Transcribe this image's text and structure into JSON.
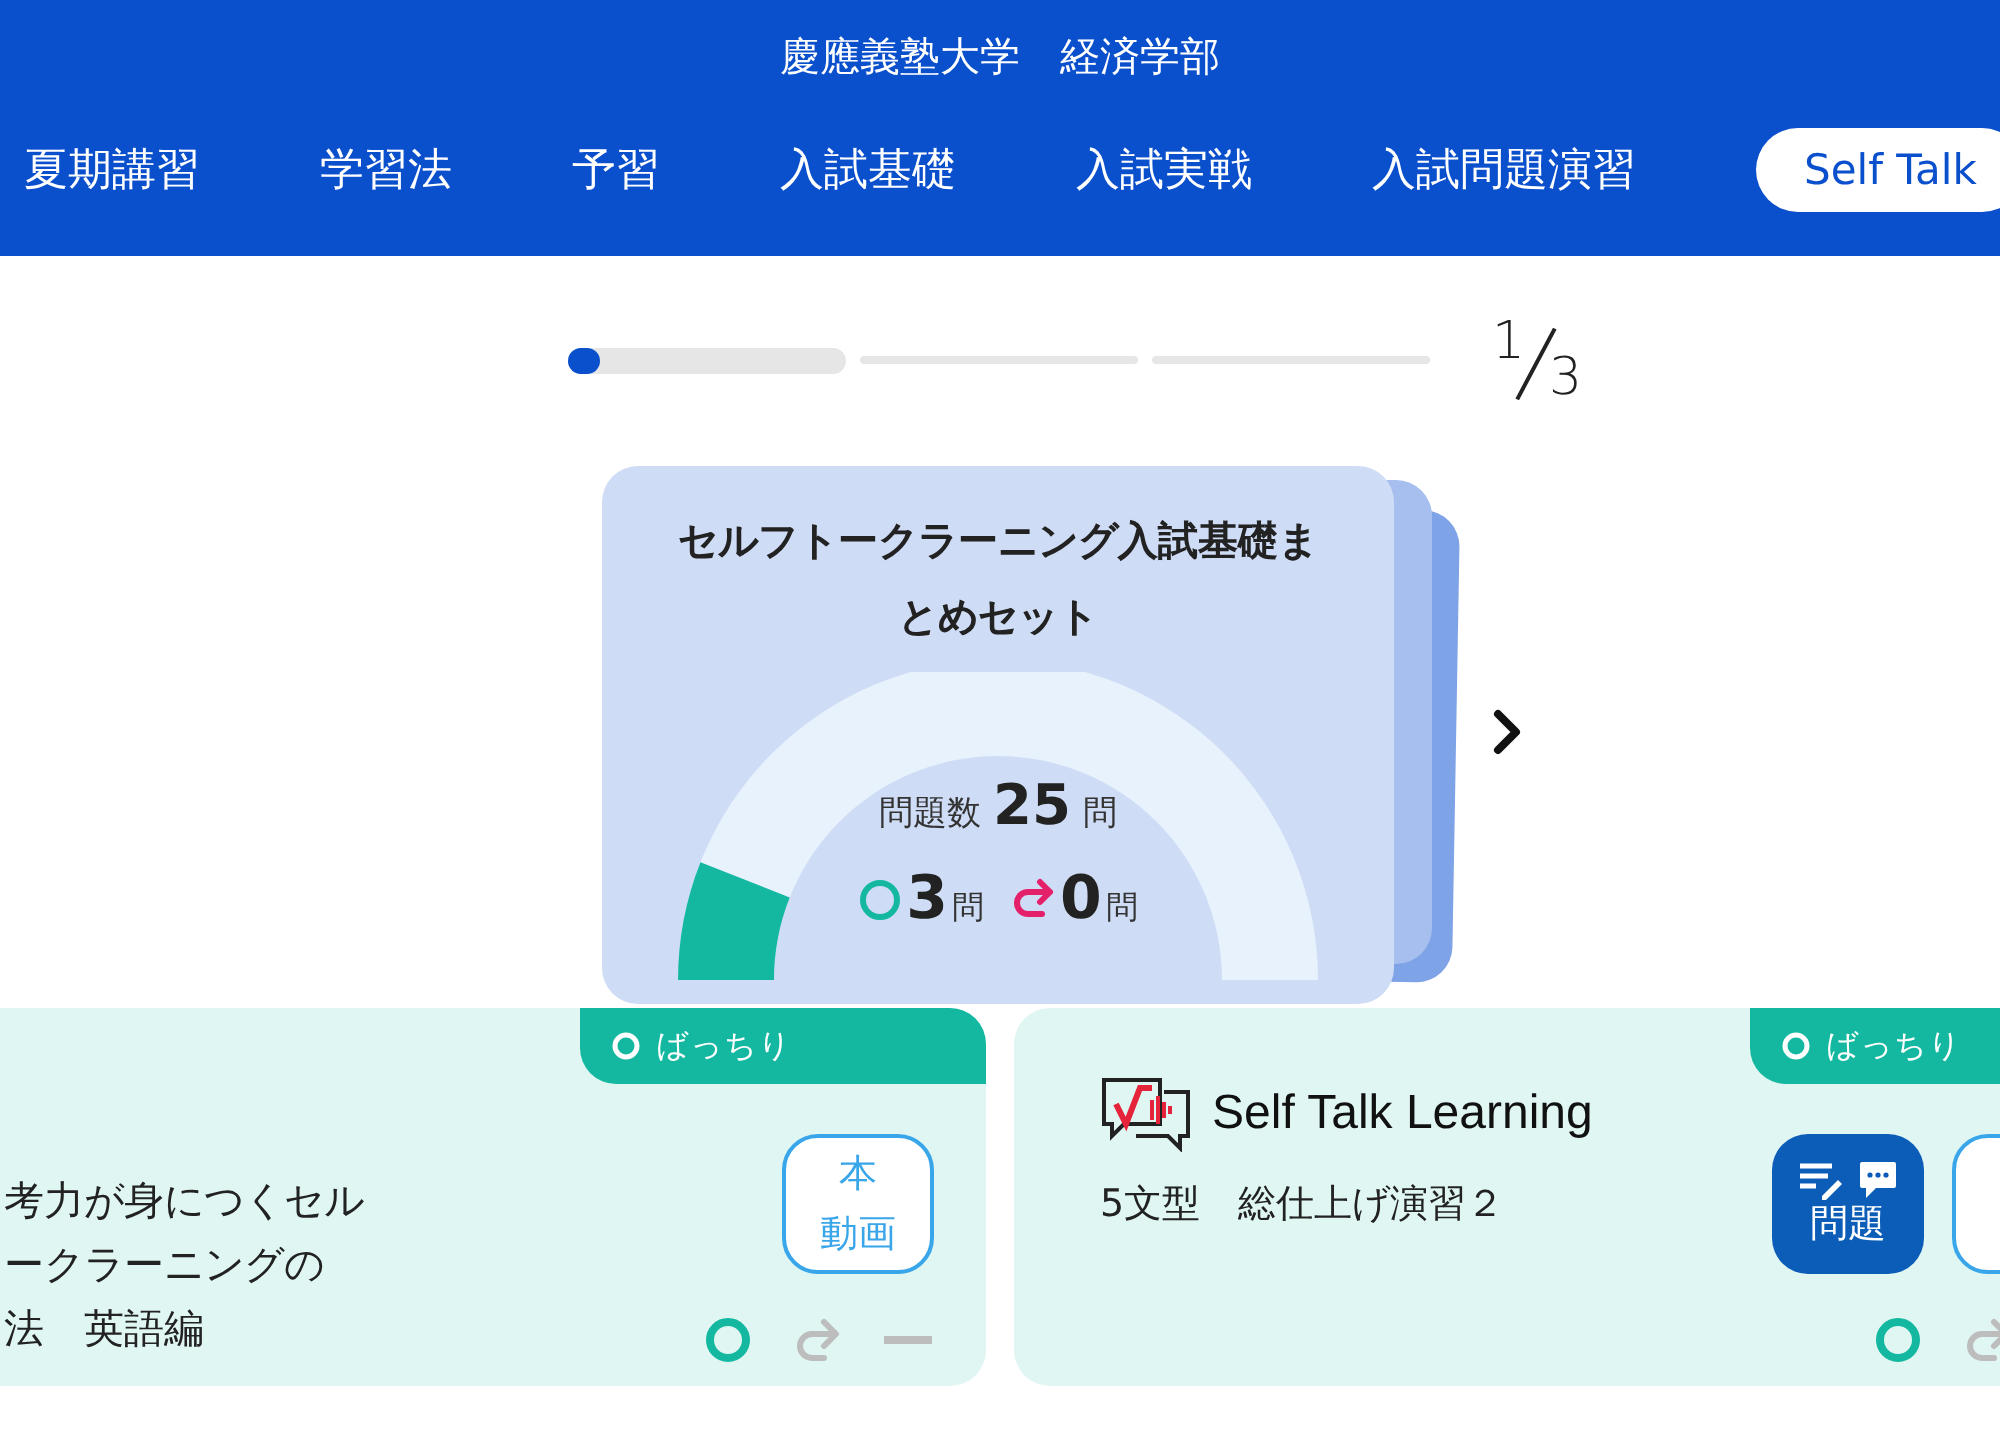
{
  "header": {
    "title": "慶應義塾大学　経済学部"
  },
  "nav": [
    {
      "label": "夏期講習",
      "selected": false
    },
    {
      "label": "学習法",
      "selected": false
    },
    {
      "label": "予習",
      "selected": false
    },
    {
      "label": "入試基礎",
      "selected": false
    },
    {
      "label": "入試実戦",
      "selected": false
    },
    {
      "label": "入試問題演習",
      "selected": false
    },
    {
      "label": "Self Talk",
      "selected": true
    }
  ],
  "progress": {
    "pages": [
      {
        "selected": true
      },
      {
        "selected": false
      },
      {
        "selected": false
      }
    ],
    "level": 0.08,
    "current": "1",
    "total": "3"
  },
  "set_card": {
    "title": "セルフトークラーニング入試基礎まとめセット",
    "level": 0.12,
    "count_label": "問題数",
    "count": "25",
    "count_unit": "問",
    "correct": "3",
    "correct_unit": "問",
    "retry": "0",
    "retry_unit": "問"
  },
  "lessons": [
    {
      "badge": "ばっちり",
      "title_lines": [
        "考力が身につくセル",
        "ークラーニングの",
        "法　英語編"
      ],
      "buttons": [
        {
          "kind": "outline",
          "label_lines": [
            "本",
            "動画"
          ]
        }
      ],
      "marks": [
        {
          "kind": "correct",
          "selected": true
        },
        {
          "kind": "retry",
          "selected": false
        },
        {
          "kind": "skip",
          "selected": false
        }
      ]
    },
    {
      "badge": "ばっちり",
      "logo": "Self Talk Learning",
      "title_lines": [
        "5文型　総仕上げ演習２"
      ],
      "buttons": [
        {
          "kind": "filled",
          "label_lines": [
            "問題"
          ]
        },
        {
          "kind": "outline"
        }
      ],
      "marks": [
        {
          "kind": "correct",
          "selected": true
        },
        {
          "kind": "retry",
          "selected": false
        }
      ]
    }
  ]
}
